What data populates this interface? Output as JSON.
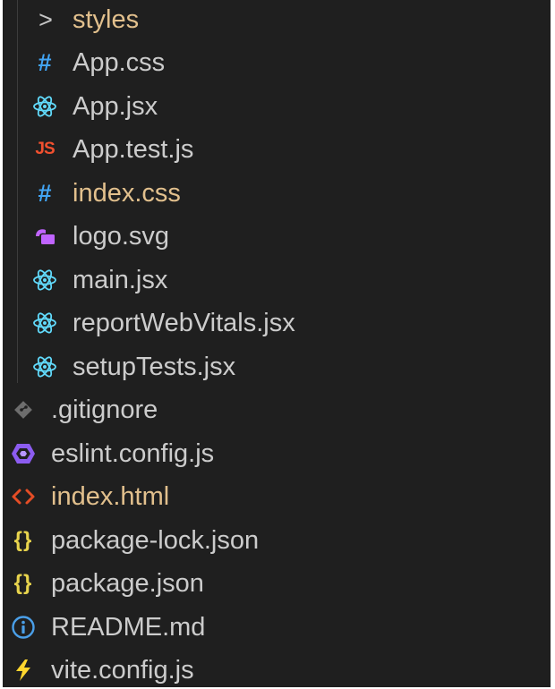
{
  "explorer": {
    "items": [
      {
        "label": "styles",
        "icon": "chevron-right-icon",
        "kind": "folder",
        "color": "#e2c08d"
      },
      {
        "label": "App.css",
        "icon": "css-hash-icon",
        "color": "#cccccc",
        "icon_color": "#42a5f5"
      },
      {
        "label": "App.jsx",
        "icon": "react-icon",
        "color": "#cccccc",
        "icon_color": "#61dafb"
      },
      {
        "label": "App.test.js",
        "icon": "js-icon",
        "color": "#cccccc",
        "icon_color": "#f1502f"
      },
      {
        "label": "index.css",
        "icon": "css-hash-icon",
        "color": "#e2c08d",
        "icon_color": "#42a5f5"
      },
      {
        "label": "logo.svg",
        "icon": "svg-icon",
        "color": "#cccccc",
        "icon_color": "#c064ff"
      },
      {
        "label": "main.jsx",
        "icon": "react-icon",
        "color": "#cccccc",
        "icon_color": "#61dafb"
      },
      {
        "label": "reportWebVitals.jsx",
        "icon": "react-icon",
        "color": "#cccccc",
        "icon_color": "#61dafb"
      },
      {
        "label": "setupTests.jsx",
        "icon": "react-icon",
        "color": "#cccccc",
        "icon_color": "#61dafb"
      },
      {
        "label": ".gitignore",
        "icon": "git-icon",
        "color": "#cccccc",
        "icon_color": "#6d6d6d"
      },
      {
        "label": "eslint.config.js",
        "icon": "eslint-icon",
        "color": "#cccccc",
        "icon_color": "#8c5cf0"
      },
      {
        "label": "index.html",
        "icon": "html-icon",
        "color": "#e2c08d",
        "icon_color": "#e44d26"
      },
      {
        "label": "package-lock.json",
        "icon": "json-icon",
        "color": "#cccccc",
        "icon_color": "#e8d44d"
      },
      {
        "label": "package.json",
        "icon": "json-icon",
        "color": "#cccccc",
        "icon_color": "#e8d44d"
      },
      {
        "label": "README.md",
        "icon": "info-icon",
        "color": "#cccccc",
        "icon_color": "#4a9fe8"
      },
      {
        "label": "vite.config.js",
        "icon": "vite-icon",
        "color": "#cccccc",
        "icon_color": "#ffd62e"
      }
    ]
  }
}
